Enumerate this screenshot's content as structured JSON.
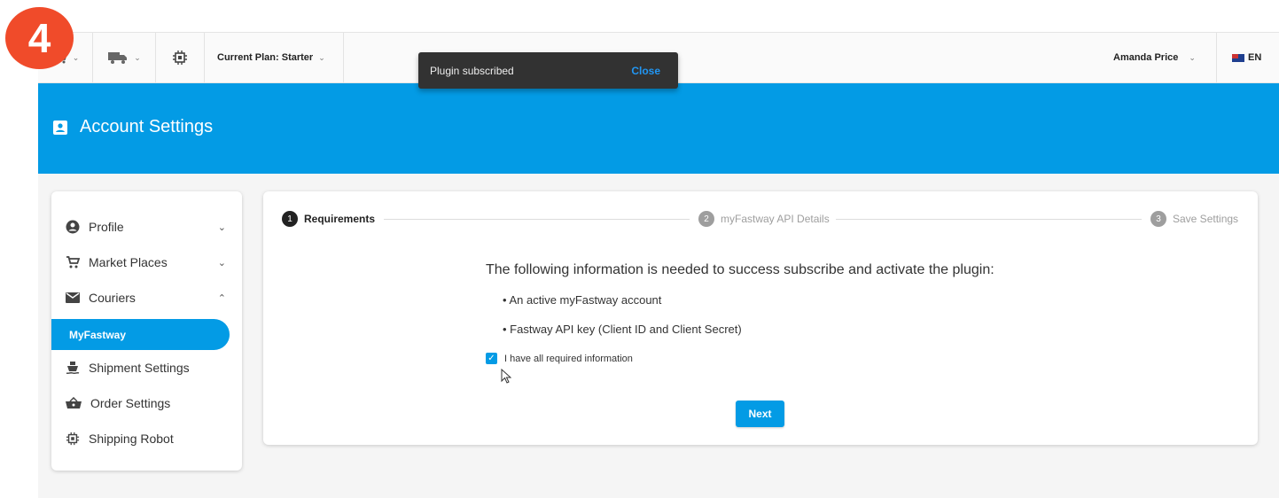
{
  "step_badge": "4",
  "topbar": {
    "segments": [
      "cart-icon",
      "truck-icon",
      "chip-icon"
    ],
    "plan_label": "Current Plan: Starter",
    "user_name": "Amanda Price",
    "language": "EN"
  },
  "snackbar": {
    "message": "Plugin subscribed",
    "action": "Close"
  },
  "banner": {
    "title": "Account Settings",
    "color": "#039be5"
  },
  "sidebar": {
    "items": [
      {
        "label": "Profile",
        "icon": "user-circle-icon",
        "caret": "down"
      },
      {
        "label": "Market Places",
        "icon": "cart-icon",
        "caret": "down"
      },
      {
        "label": "Couriers",
        "icon": "envelope-icon",
        "caret": "up"
      },
      {
        "label": "Shipment Settings",
        "icon": "ship-icon"
      },
      {
        "label": "Order Settings",
        "icon": "basket-icon"
      },
      {
        "label": "Shipping Robot",
        "icon": "chip-icon"
      }
    ],
    "active_sub_item": "MyFastway"
  },
  "stepper": {
    "steps": [
      {
        "number": "1",
        "label": "Requirements",
        "state": "active"
      },
      {
        "number": "2",
        "label": "myFastway API Details",
        "state": "idle"
      },
      {
        "number": "3",
        "label": "Save Settings",
        "state": "idle"
      }
    ]
  },
  "requirements": {
    "title": "The following information is needed to success subscribe and activate the plugin:",
    "bullets": [
      "• An active myFastway account",
      "• Fastway API key (Client ID and Client Secret)"
    ],
    "checkbox_label": "I have all required information",
    "checkbox_checked": true,
    "next_label": "Next"
  }
}
